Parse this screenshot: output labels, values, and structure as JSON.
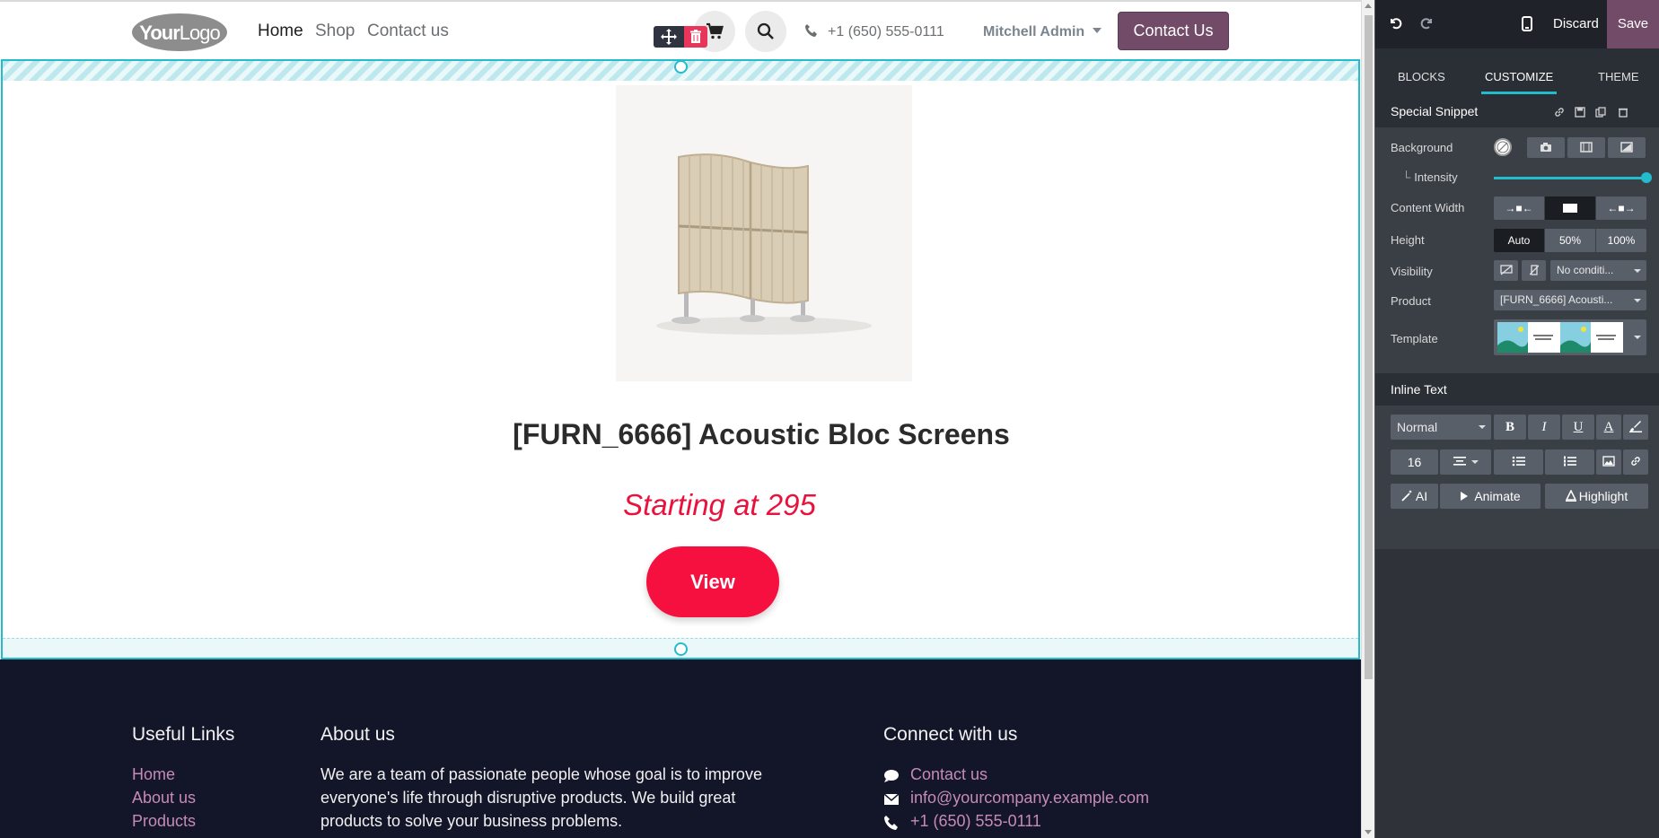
{
  "header": {
    "logo_text_bold": "Your",
    "logo_text_thin": "Logo",
    "nav": [
      "Home",
      "Shop",
      "Contact us"
    ],
    "phone": "+1 (650) 555-0111",
    "user": "Mitchell Admin",
    "cta_label": "Contact Us"
  },
  "snippet": {
    "product_title": "[FURN_6666] Acoustic Bloc Screens",
    "price_text": "Starting at 295",
    "view_label": "View"
  },
  "footer": {
    "useful_links_title": "Useful Links",
    "useful_links": [
      "Home",
      "About us",
      "Products"
    ],
    "about_title": "About us",
    "about_text": "We are a team of passionate people whose goal is to improve everyone's life through disruptive products. We build great products to solve your business problems.",
    "connect_title": "Connect with us",
    "connect_items": [
      "Contact us",
      "info@yourcompany.example.com",
      "+1 (650) 555-0111"
    ]
  },
  "editor": {
    "discard_label": "Discard",
    "save_label": "Save",
    "tabs": [
      "BLOCKS",
      "CUSTOMIZE",
      "THEME"
    ],
    "active_tab": "CUSTOMIZE",
    "snippet_section_title": "Special Snippet",
    "rows": {
      "background": "Background",
      "intensity": "Intensity",
      "intensity_value": 1.0,
      "content_width": "Content Width",
      "height": "Height",
      "visibility": "Visibility",
      "product": "Product",
      "template": "Template"
    },
    "height_options": [
      "Auto",
      "50%",
      "100%"
    ],
    "height_selected": "Auto",
    "visibility_value": "No conditi...",
    "product_value": "[FURN_6666] Acousti...",
    "inline_text_title": "Inline Text",
    "text_style": "Normal",
    "font_size": "16",
    "ai_label": "AI",
    "animate_label": "Animate",
    "highlight_label": "Highlight"
  },
  "colors": {
    "brand": "#714b67",
    "accent": "#f5103f",
    "snippet_outline": "#22bccc",
    "footer_bg": "#131629"
  }
}
